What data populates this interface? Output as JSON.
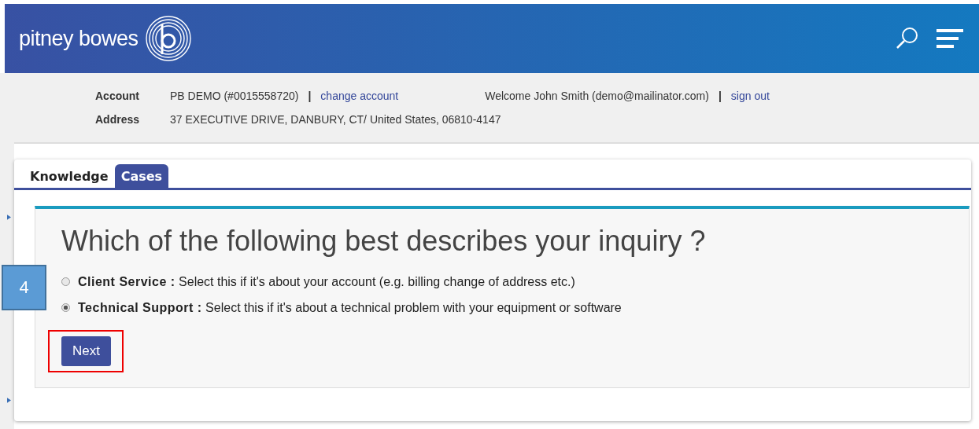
{
  "header": {
    "logo": "pitney bowes"
  },
  "account_bar": {
    "account_label": "Account",
    "account_value": "PB DEMO (#0015558720)",
    "separator_1": "|",
    "change_link": "change account",
    "welcome": "Welcome John Smith (demo@mailinator.com)",
    "separator_2": "|",
    "signout_link": "sign out",
    "address_label": "Address",
    "address_value": "37 EXECUTIVE DRIVE, DANBURY, CT/ United States, 06810-4147"
  },
  "tabs": [
    {
      "label": "Knowledge",
      "selected": false
    },
    {
      "label": "Cases",
      "selected": true
    }
  ],
  "question": "Which of the following best describes your inquiry ?",
  "options": [
    {
      "text": "**Client Service :** Select this if it's about your account (e.g. billing change of address etc.)",
      "selected": false
    },
    {
      "text": "**Technical Support :** Select this if it's about a technical problem with your equipment or software",
      "selected": true
    }
  ],
  "next_button": "Next",
  "callout": "4"
}
